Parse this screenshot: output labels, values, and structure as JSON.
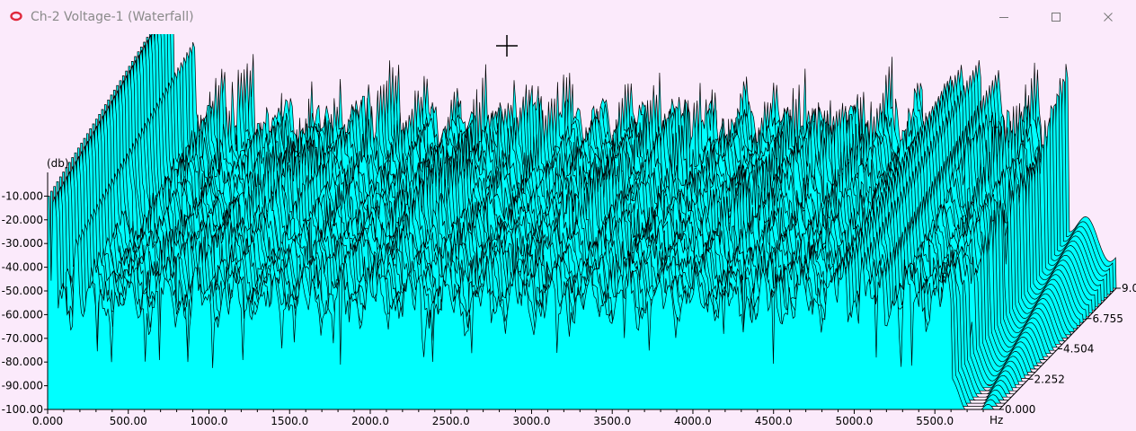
{
  "window": {
    "title": "Ch-2 Voltage-1 (Waterfall)",
    "icons": {
      "app": "waveform-app-icon",
      "minimize": "minimize-icon",
      "maximize": "maximize-icon",
      "close": "close-icon"
    }
  },
  "colors": {
    "background": "#fbeafb",
    "surface_fill": "#00ffff",
    "surface_line": "#000000",
    "title_text": "#8a8a8a",
    "axis": "#000000"
  },
  "chart_data": {
    "type": "waterfall",
    "title": "",
    "ylabel": "(db)",
    "xlabel": "Hz",
    "ylim": [
      -100,
      0
    ],
    "xlim": [
      0,
      5900
    ],
    "zlim": [
      0,
      9.0
    ],
    "y_ticks": [
      "-10.000",
      "-20.000",
      "-30.000",
      "-40.000",
      "-50.000",
      "-60.000",
      "-70.000",
      "-80.000",
      "-90.000",
      "-100.00"
    ],
    "x_ticks": [
      "0.000",
      "500.00",
      "1000.0",
      "1500.0",
      "2000.0",
      "2500.0",
      "3000.0",
      "3500.0",
      "4000.0",
      "4500.0",
      "5000.0",
      "5500.0"
    ],
    "z_ticks": [
      "0.000",
      "2.252",
      "4.504",
      "6.755",
      "9.0"
    ],
    "peaks_db": [
      {
        "hz": 40,
        "db": -7
      },
      {
        "hz": 180,
        "db": -25
      },
      {
        "hz": 4870,
        "db": -40
      },
      {
        "hz": 4940,
        "db": -37
      },
      {
        "hz": 5050,
        "db": -35
      },
      {
        "hz": 5170,
        "db": -40
      }
    ],
    "floor_db": -55,
    "min_db": -83,
    "slices": 40,
    "cutoff_hz": 5600
  }
}
